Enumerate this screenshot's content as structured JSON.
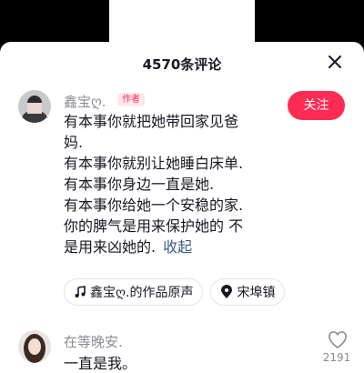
{
  "header": {
    "title": "4570条评论"
  },
  "comments": [
    {
      "username": "鑫宝ღ.",
      "badge": "作者",
      "follow_label": "关注",
      "lines": [
        "有本事你就把她带回家见爸",
        "妈.",
        "有本事你就别让她睡白床单.",
        "有本事你身边一直是她.",
        "有本事你给她一个安稳的家.",
        "你的脾气是用来保护她的 不",
        "是用来凶她的."
      ],
      "collapse_label": "收起",
      "chips": [
        {
          "icon": "music-note-icon",
          "label": "鑫宝ღ.的作品原声"
        },
        {
          "icon": "location-pin-icon",
          "label": "宋埠镇"
        }
      ]
    },
    {
      "username": "在等晚安.",
      "text": "一直是我。",
      "likes": "2191"
    }
  ],
  "colors": {
    "accent": "#fe2c55",
    "link": "#3b5a8a",
    "muted": "#8a8b91"
  }
}
